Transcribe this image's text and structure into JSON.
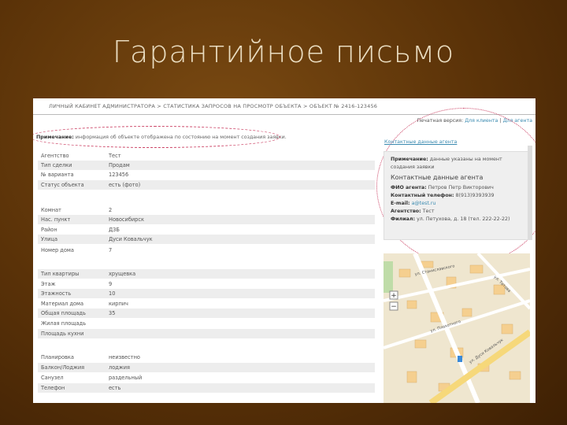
{
  "slide_title": "Гарантийное письмо",
  "breadcrumb": "ЛИЧНЫЙ КАБИНЕТ АДМИНИСТРАТОРА > СТАТИСТИКА ЗАПРОСОВ НА ПРОСМОТР ОБЪЕКТА > ОБЪЕКТ № 2416-123456",
  "note_label": "Примечание:",
  "note_text": " информация об объекте отображена по состоянию на момент создания заявки.",
  "print": {
    "label": "Печатная версия:",
    "client": "Для клиента",
    "sep": "|",
    "agent": "Для агента"
  },
  "contacts_link": "Контактные данные агента",
  "rows": [
    {
      "label": "Агентство",
      "value": "Тест"
    },
    {
      "label": "Тип сделки",
      "value": "Продам"
    },
    {
      "label": "№ варианта",
      "value": "123456"
    },
    {
      "label": "Статус объекта",
      "value": "есть (фото)"
    },
    {
      "label": "Комнат",
      "value": "2"
    },
    {
      "label": "Нас. пункт",
      "value": "Новосибирск"
    },
    {
      "label": "Район",
      "value": "ДЗБ"
    },
    {
      "label": "Улица",
      "value": "Дуси Ковальчук"
    },
    {
      "label": "Номер дома",
      "value": "7"
    },
    {
      "label": "Тип квартиры",
      "value": "хрущевка"
    },
    {
      "label": "Этаж",
      "value": "9"
    },
    {
      "label": "Этажность",
      "value": "10"
    },
    {
      "label": "Материал дома",
      "value": "кирпич"
    },
    {
      "label": "Общая площадь",
      "value": "35"
    },
    {
      "label": "Жилая площадь",
      "value": ""
    },
    {
      "label": "Площадь кухни",
      "value": ""
    },
    {
      "label": "Планировка",
      "value": "неизвестно"
    },
    {
      "label": "Балкон/Лоджия",
      "value": "лоджия"
    },
    {
      "label": "Санузел",
      "value": "раздельный"
    },
    {
      "label": "Телефон",
      "value": "есть"
    }
  ],
  "contact": {
    "note_label": "Примечание:",
    "note_text": " данные указаны на момент создания заявки",
    "heading": "Контактные данные агента",
    "fio_label": "ФИО агента:",
    "fio": " Петров Петр Викторович",
    "phone_label": "Контактный телефон:",
    "phone": " 8(913)9393939",
    "email_label": "E-mail:",
    "email": " a@test.ru",
    "agency_label": "Агентство:",
    "agency": " Тест",
    "office_label": "Филиал:",
    "office": " ул. Петухова, д. 18 (тел. 222-22-22)"
  },
  "map": {
    "zoom_in": "+",
    "zoom_out": "−",
    "streets": [
      "ул. Станиславского",
      "ул. Дуси Ковальчук",
      "ул. Плахотного",
      "ул. Титова"
    ]
  }
}
